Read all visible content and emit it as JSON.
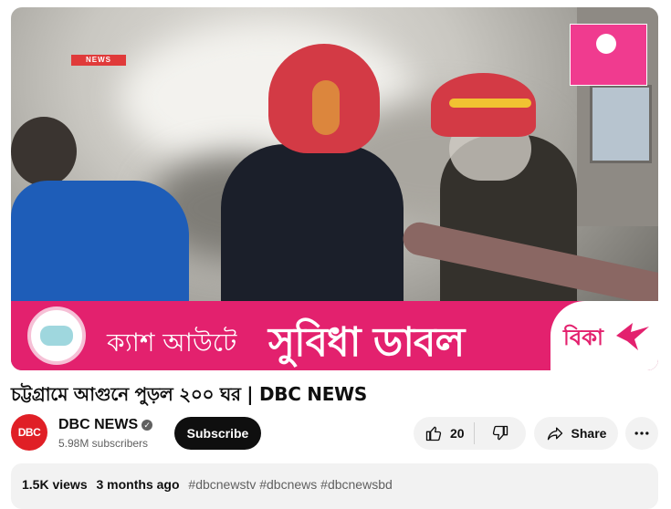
{
  "video": {
    "title": "চট্টগ্রামে আগুনে পুড়ল ২০০ ঘর | DBC NEWS",
    "tv_logo": "NEWS",
    "banner": {
      "small_text": "ক্যাশ আউটে",
      "big_text": "সুবিধা ডাবল",
      "brand": "বিকা"
    }
  },
  "channel": {
    "avatar_text": "DBC",
    "name": "DBC NEWS",
    "verified_mark": "✓",
    "subscribers": "5.98M subscribers",
    "subscribe_label": "Subscribe"
  },
  "actions": {
    "like_count": "20",
    "share_label": "Share"
  },
  "description": {
    "views": "1.5K views",
    "ago": "3 months ago",
    "tags": "#dbcnewstv #dbcnews #dbcnewsbd"
  },
  "icons": [
    "thumb-up-icon",
    "thumb-down-icon",
    "share-icon",
    "more-icon",
    "verified-icon"
  ],
  "colors": {
    "banner": "#e3216e",
    "subscribe_bg": "#0f0f0f",
    "pill_bg": "#f2f2f2",
    "avatar": "#e01f26"
  }
}
